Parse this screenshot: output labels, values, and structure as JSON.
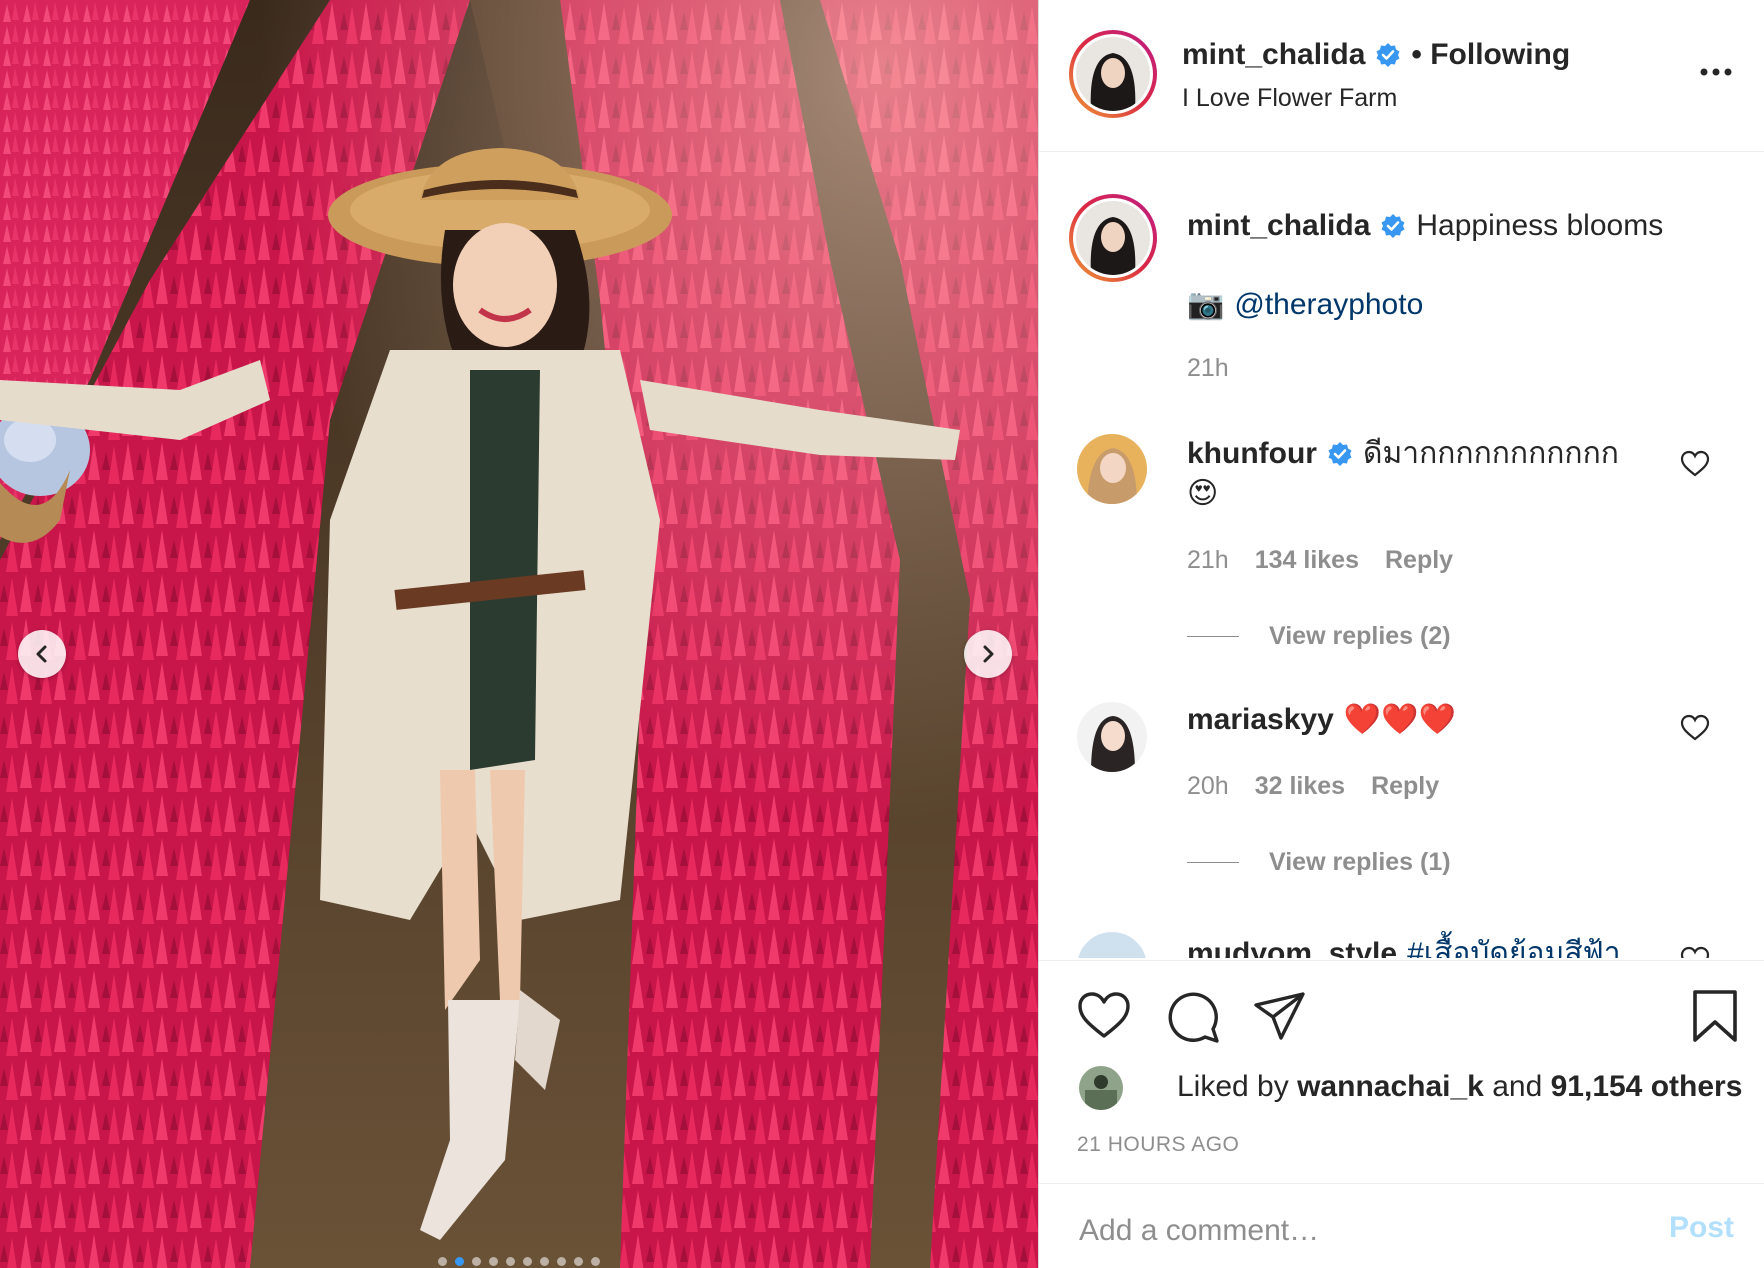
{
  "post": {
    "author": "mint_chalida",
    "follow_status": "• Following",
    "location": "I Love Flower Farm",
    "more_icon": "more-horizontal-icon",
    "carousel_count": 10,
    "carousel_active_index": 1
  },
  "caption": {
    "username": "mint_chalida",
    "text": "Happiness blooms",
    "camera_emoji": "📷",
    "mention": "@therayphoto",
    "time": "21h"
  },
  "comments": [
    {
      "username": "khunfour",
      "verified": true,
      "text": "ดีมากกกกกกกกกกก",
      "emoji": "😍",
      "time": "21h",
      "likes": "134 likes",
      "reply_label": "Reply",
      "view_replies": "View replies (2)"
    },
    {
      "username": "mariaskyy",
      "verified": false,
      "text": "❤️❤️❤️",
      "time": "20h",
      "likes": "32 likes",
      "reply_label": "Reply",
      "view_replies": "View replies (1)"
    },
    {
      "username": "mudyom_style",
      "verified": false,
      "text": "#เสื้อบัดย้อมสีฟ้า"
    }
  ],
  "actions": {
    "like_icon": "heart-icon",
    "comment_icon": "comment-icon",
    "share_icon": "share-icon",
    "save_icon": "bookmark-icon"
  },
  "likes": {
    "prefix": "Liked by",
    "user": "wannachai_k",
    "middle": "and",
    "count": "91,154 others"
  },
  "timestamp": "21 HOURS AGO",
  "add_comment": {
    "placeholder": "Add a comment…",
    "post_label": "Post"
  },
  "colors": {
    "verified_blue": "#3897f0",
    "link_blue": "#00376b",
    "muted": "#8e8e8e",
    "post_disabled": "#b2dffc"
  }
}
